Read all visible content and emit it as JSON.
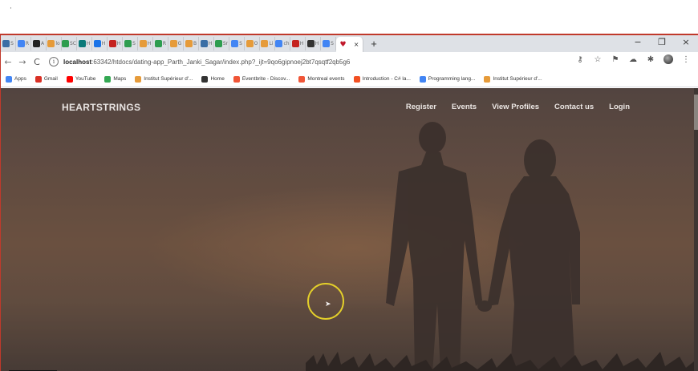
{
  "screen": {
    "corner_mark": "·"
  },
  "browser": {
    "tabs": [
      {
        "label": "S",
        "color": "#3b6ea5"
      },
      {
        "label": "R",
        "color": "#4285f4"
      },
      {
        "label": "A",
        "color": "#222222"
      },
      {
        "label": "lo",
        "color": "#e69b3a"
      },
      {
        "label": "SC",
        "color": "#2e9d4f"
      },
      {
        "label": "H",
        "color": "#0b7a7a"
      },
      {
        "label": "H",
        "color": "#1a73e8"
      },
      {
        "label": "H",
        "color": "#c5221f"
      },
      {
        "label": "S",
        "color": "#2e9d4f"
      },
      {
        "label": "H",
        "color": "#e69b3a"
      },
      {
        "label": "R",
        "color": "#2e9d4f"
      },
      {
        "label": "G",
        "color": "#e69b3a"
      },
      {
        "label": "B",
        "color": "#e69b3a"
      },
      {
        "label": "H",
        "color": "#3b6ea5"
      },
      {
        "label": "Sr",
        "color": "#2e9d4f"
      },
      {
        "label": "S",
        "color": "#4285f4"
      },
      {
        "label": "O",
        "color": "#e69b3a"
      },
      {
        "label": "Li",
        "color": "#e69b3a"
      },
      {
        "label": "ch",
        "color": "#4285f4"
      },
      {
        "label": "H",
        "color": "#c5221f"
      },
      {
        "label": "H",
        "color": "#333333"
      },
      {
        "label": "S",
        "color": "#4285f4"
      }
    ],
    "active_tab": {
      "close": "×"
    },
    "new_tab": "+",
    "window_controls": {
      "minimize": "−",
      "restore": "❐",
      "close": "×"
    },
    "nav": {
      "back": "←",
      "forward": "→",
      "reload": "C"
    },
    "url": {
      "host": "localhost",
      "rest": ":63342/htdocs/dating-app_Parth_Janki_Sagar/index.php?_ijt=9qo6gipnoej2bt7qsqtf2qb5g6"
    },
    "toolbar_icons": {
      "key": "⚷",
      "star": "☆",
      "flag": "⚑",
      "cloud": "☁",
      "puzzle": "✱",
      "menu": "⋮"
    },
    "bookmarks": [
      {
        "label": "Apps",
        "color": "#4285f4"
      },
      {
        "label": "Gmail",
        "color": "#d93025"
      },
      {
        "label": "YouTube",
        "color": "#ff0000"
      },
      {
        "label": "Maps",
        "color": "#34a853"
      },
      {
        "label": "Institut Supérieur d'...",
        "color": "#e69b3a"
      },
      {
        "label": "Home",
        "color": "#333333"
      },
      {
        "label": "Eventbrite - Discov...",
        "color": "#f05537"
      },
      {
        "label": "Montreal events",
        "color": "#f05537"
      },
      {
        "label": "Introduction - C# la...",
        "color": "#f25022"
      },
      {
        "label": "Programming lang...",
        "color": "#4285f4"
      },
      {
        "label": "Institut Supérieur d'...",
        "color": "#e69b3a"
      }
    ]
  },
  "site": {
    "brand": "HEARTSTRINGS",
    "nav_links": [
      "Register",
      "Events",
      "View Profiles",
      "Contact us",
      "Login"
    ]
  },
  "colors": {
    "accent_ring": "#e3cf2a",
    "window_border": "#c0392b"
  }
}
